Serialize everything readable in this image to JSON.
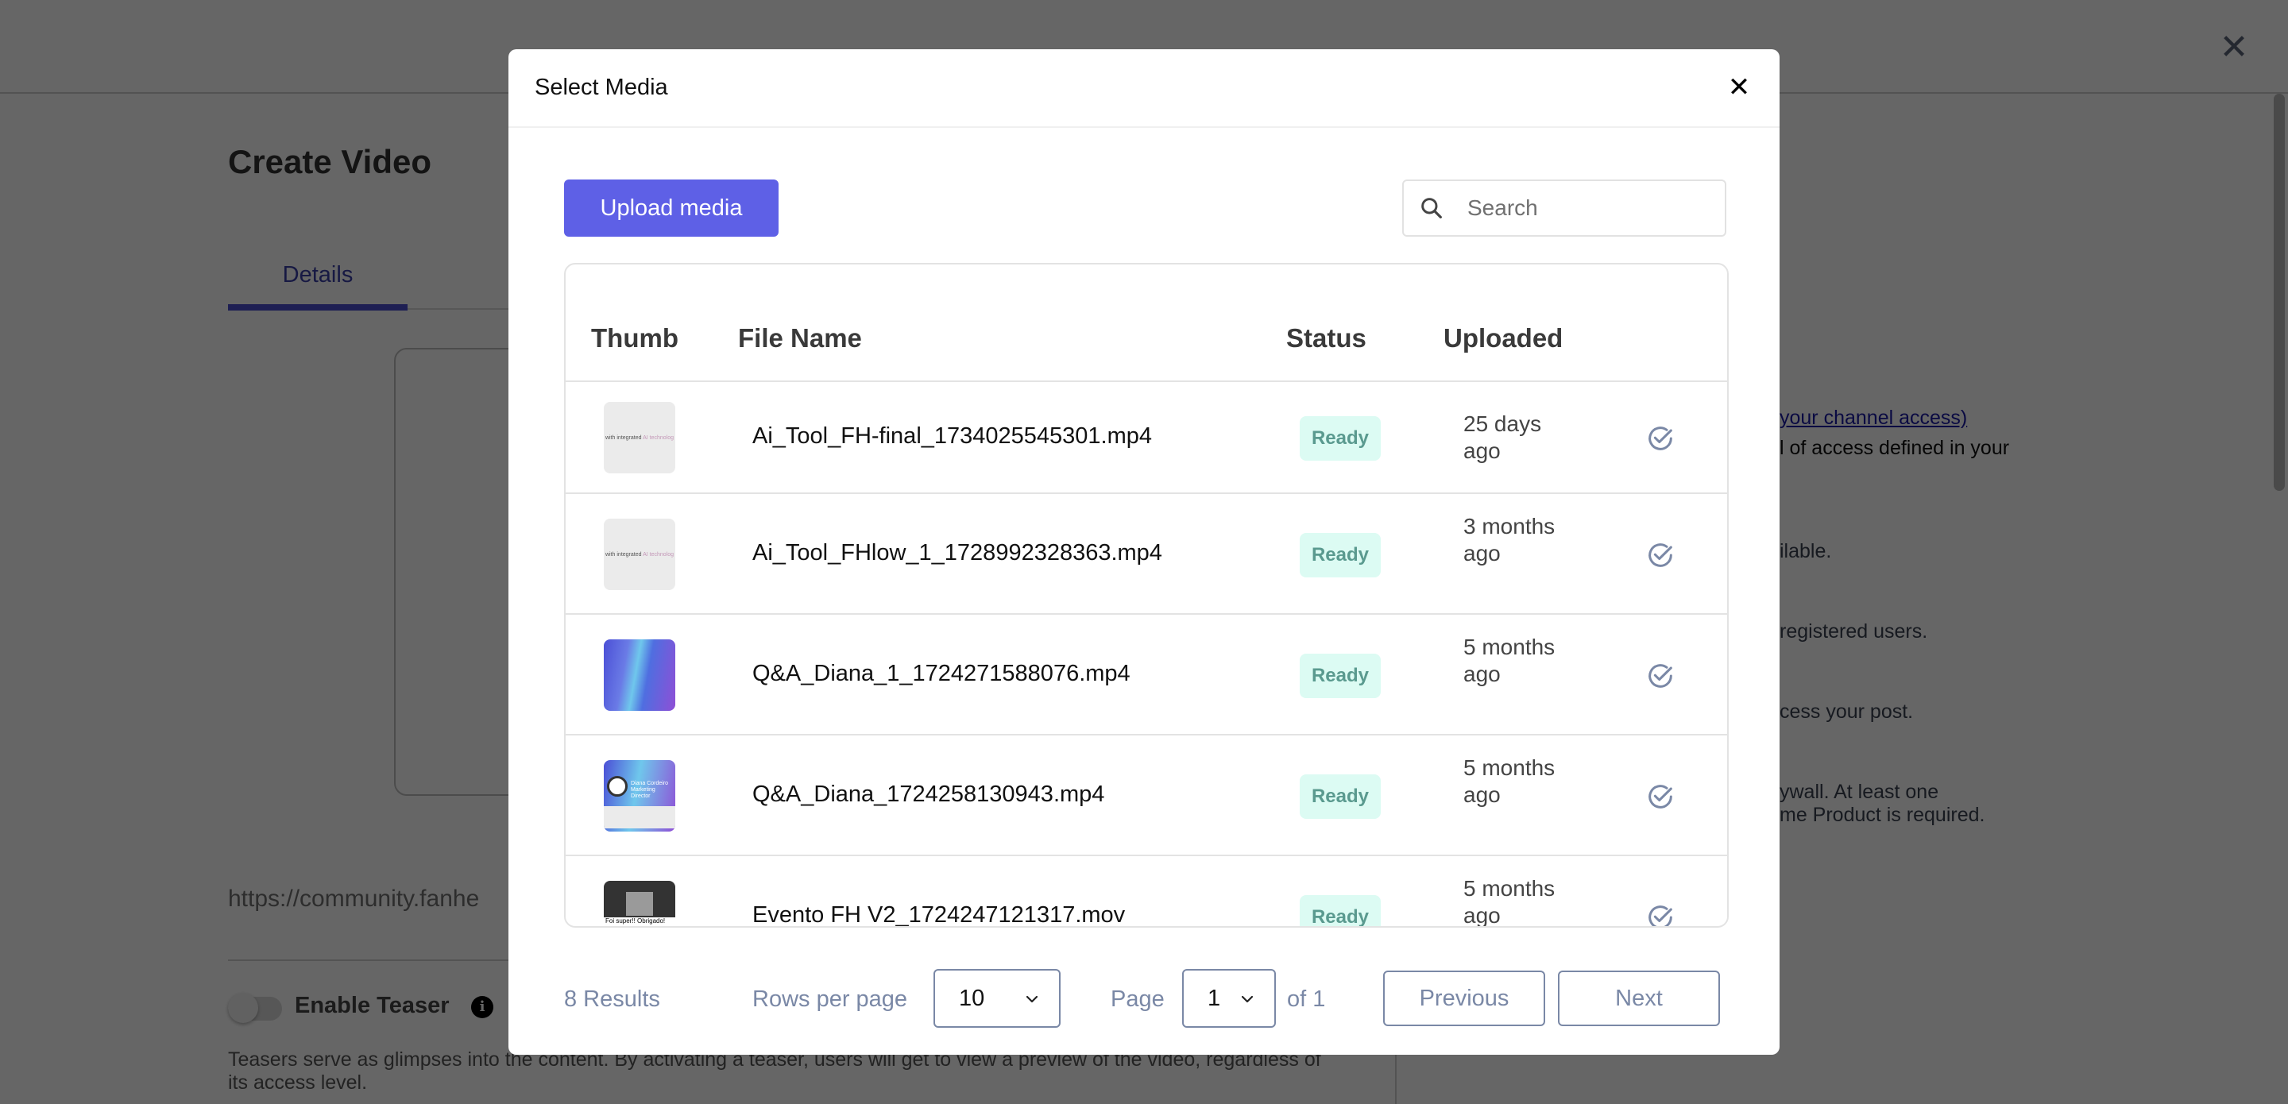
{
  "background": {
    "page_title": "Create Video",
    "tabs": [
      {
        "label": "Details",
        "active": true
      }
    ],
    "url_text": "https://community.fanhe",
    "teaser": {
      "label": "Enable Teaser",
      "enabled": false,
      "description": "Teasers serve as glimpses into the content. By activating a teaser, users will get to view a preview of the video, regardless of its access level."
    },
    "right_panel": {
      "link_text": "your channel access)",
      "line_1": "l of access defined in your",
      "line_2": "ilable.",
      "line_3": "registered users.",
      "line_4": "cess your post.",
      "line_5": "ywall. At least one",
      "line_6": "me Product is required."
    }
  },
  "modal": {
    "title": "Select Media",
    "upload_button": "Upload media",
    "search": {
      "placeholder": "Search",
      "value": ""
    },
    "columns": [
      "Thumb",
      "File Name",
      "Status",
      "Uploaded"
    ],
    "rows": [
      {
        "thumb": "ai-tool-frame",
        "thumb_text": "with integrated",
        "thumb_accent": "AI technolog",
        "file_name": "Ai_Tool_FH-final_1734025545301.mp4",
        "status": "Ready",
        "uploaded": "25 days ago"
      },
      {
        "thumb": "ai-tool-frame",
        "thumb_text": "with integrated",
        "thumb_accent": "AI technolog",
        "file_name": "Ai_Tool_FHlow_1_1728992328363.mp4",
        "status": "Ready",
        "uploaded": "3 months ago"
      },
      {
        "thumb": "gradient-frame",
        "file_name": "Q&A_Diana_1_1724271588076.mp4",
        "status": "Ready",
        "uploaded": "5 months ago"
      },
      {
        "thumb": "diana-frame",
        "thumb_text": "Diana Cordeiro",
        "thumb_accent": "Marketing Director",
        "file_name": "Q&A_Diana_1724258130943.mp4",
        "status": "Ready",
        "uploaded": "5 months ago"
      },
      {
        "thumb": "evento-frame",
        "thumb_text": "Foi super!! Obrigado! Tudo perfeito como sempre.",
        "file_name": "Evento FH V2_1724247121317.mov",
        "status": "Ready",
        "uploaded": "5 months ago"
      }
    ],
    "footer": {
      "results": "8 Results",
      "rows_per_page_label": "Rows per page",
      "rows_per_page": "10",
      "page_label": "Page",
      "page": "1",
      "of_label": "of 1",
      "previous": "Previous",
      "next": "Next"
    }
  },
  "colors": {
    "primary": "#5e60e6",
    "status_ready_bg": "#dcfbf3",
    "status_ready_text": "#5a9a8f",
    "muted": "#7a88a6"
  }
}
